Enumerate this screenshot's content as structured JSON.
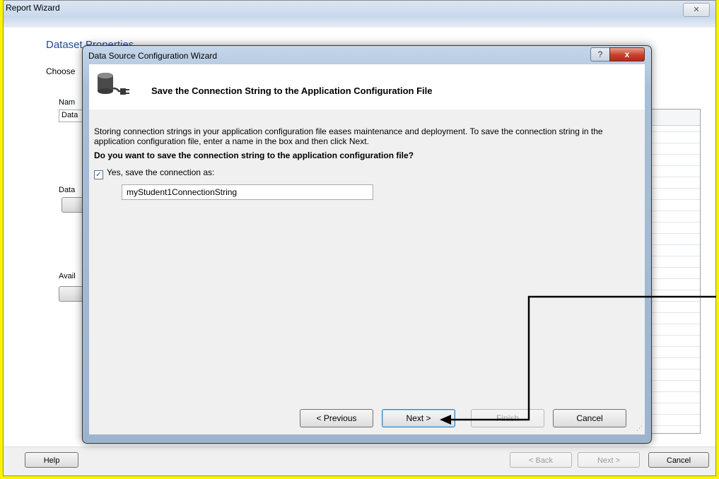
{
  "report_wizard": {
    "title": "Report Wizard",
    "close_glyph": "✕",
    "section_title": "Dataset Properties",
    "choose_label": "Choose",
    "name_label": "Nam",
    "name_value": "Data",
    "data_label": "Data",
    "avail_label": "Avail",
    "help_button": "Help",
    "back_button": "< Back",
    "next_button": "Next >",
    "cancel_button": "Cancel"
  },
  "dialog": {
    "title": "Data Source Configuration Wizard",
    "help_glyph": "?",
    "close_glyph": "x",
    "heading": "Save the Connection String to the Application Configuration File",
    "description": "Storing connection strings in your application configuration file eases maintenance and deployment. To save the connection string in the application configuration file, enter a name in the box and then click Next.",
    "question": "Do you want to save the connection string to the application configuration file?",
    "checkbox_label": "Yes, save the connection as:",
    "checkbox_checked": true,
    "connection_name": "myStudent1ConnectionString",
    "buttons": {
      "previous": "< Previous",
      "next": "Next >",
      "finish": "Finish",
      "cancel": "Cancel"
    }
  },
  "icons": {
    "database": "database-connection-icon",
    "check": "✓",
    "grip": "⋰"
  },
  "colors": {
    "highlight_background": "#fff200",
    "section_title": "#1f4e96",
    "dialog_frame": "#a9bfd8",
    "close_button": "#c7402b"
  }
}
